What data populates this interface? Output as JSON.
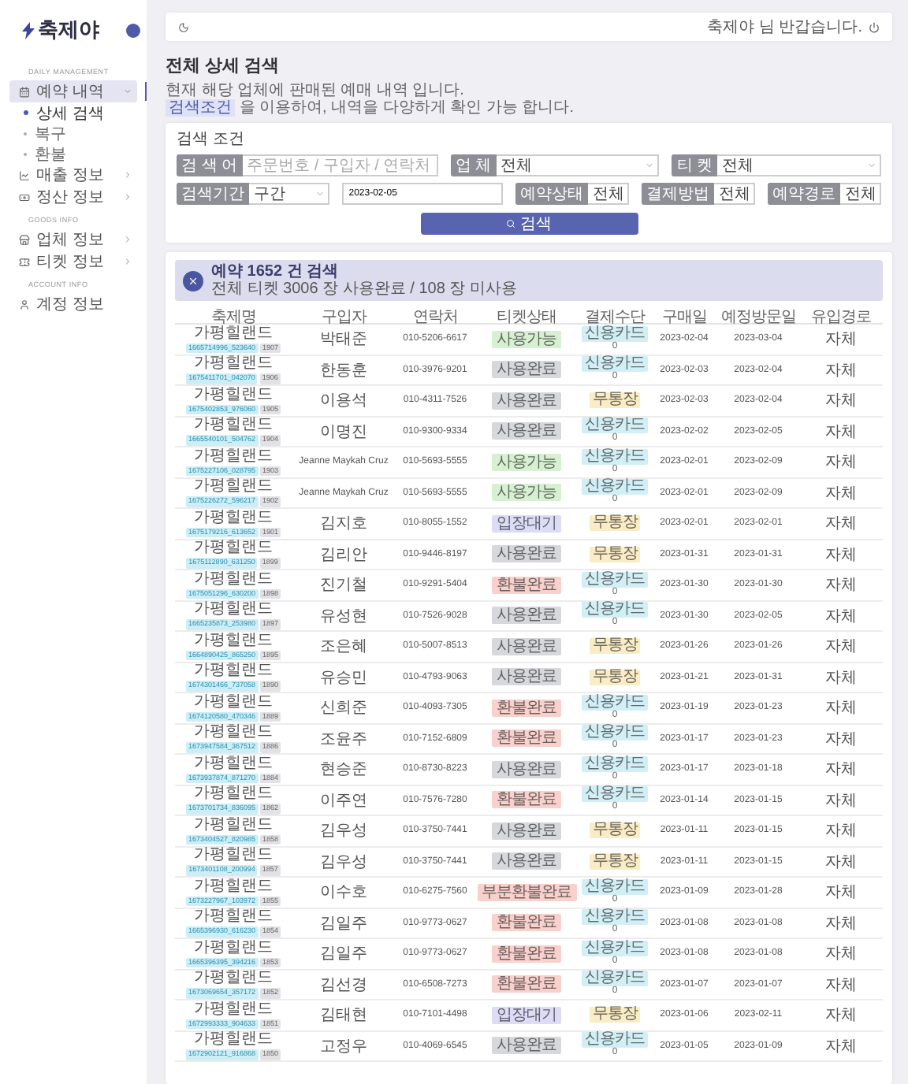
{
  "sidebar": {
    "logo": "축제야",
    "sections": [
      {
        "title": "DAILY MANAGEMENT",
        "items": [
          {
            "kind": "menu",
            "label": "예약 내역",
            "selected": true,
            "expanded": true,
            "children": [
              {
                "label": "상세 검색",
                "selected": true
              },
              {
                "label": "복구",
                "selected": false
              },
              {
                "label": "환불",
                "selected": false
              }
            ]
          },
          {
            "kind": "menu",
            "label": "매출 정보",
            "selected": false,
            "expanded": false
          },
          {
            "kind": "menu",
            "label": "정산 정보",
            "selected": false,
            "expanded": false
          }
        ]
      },
      {
        "title": "GOODS INFO",
        "items": [
          {
            "kind": "menu",
            "label": "업체 정보",
            "selected": false,
            "expanded": false
          },
          {
            "kind": "menu",
            "label": "티켓 정보",
            "selected": false,
            "expanded": false
          }
        ]
      },
      {
        "title": "ACCOUNT INFO",
        "items": [
          {
            "kind": "link",
            "label": "계정 정보",
            "selected": false
          }
        ]
      }
    ]
  },
  "header": {
    "greeting": "축제야 님 반갑습니다."
  },
  "page": {
    "title": "전체 상세 검색",
    "description": "현재 해당 업체에 판매된 예매 내역 입니다.",
    "hint_chip": "검색조건",
    "hint": "을 이용하여, 내역을 다양하게 확인 가능 합니다."
  },
  "search": {
    "title": "검색 조건",
    "primary_filters": [
      {
        "kind": "text",
        "label": "검 색 어",
        "placeholder": "주문번호 / 구입자 / 연락처"
      },
      {
        "kind": "select",
        "label": "업 체",
        "value": "전체"
      },
      {
        "kind": "select",
        "label": "티 켓",
        "value": "전체"
      }
    ],
    "secondary_filters": [
      {
        "kind": "select",
        "label": "검색기간",
        "value": "구간"
      },
      {
        "kind": "date",
        "value": "2023-02-05"
      },
      {
        "kind": "select",
        "label": "예약상태",
        "value": "전체"
      },
      {
        "kind": "select",
        "label": "결제방법",
        "value": "전체"
      },
      {
        "kind": "select",
        "label": "예약경로",
        "value": "전체"
      }
    ],
    "button": "검색"
  },
  "results": {
    "title": "예약 1652 건 검색",
    "subtitle": "전체 티켓 3006 장 사용완료 / 108 장 미사용",
    "columns": [
      "축제명",
      "구입자",
      "연락처",
      "티켓상태",
      "결제수단",
      "구매일",
      "예정방문일",
      "유입경로"
    ],
    "rows": [
      {
        "festival": "가평힐랜드",
        "order_no": "1665714996_523640",
        "ticket_no": "1907",
        "buyer": "박태준",
        "phone": "010-5206-6617",
        "status": {
          "label": "사용가능",
          "color": "#d8f0d2"
        },
        "payment": {
          "label": "신용카드",
          "color": "#d2eff6",
          "amount": "0"
        },
        "purchased": "2023-02-04",
        "visit": "2023-03-04",
        "channel": "자체"
      },
      {
        "festival": "가평힐랜드",
        "order_no": "1675411701_042070",
        "ticket_no": "1906",
        "buyer": "한동훈",
        "phone": "010-3976-9201",
        "status": {
          "label": "사용완료",
          "color": "#d6d8dc"
        },
        "payment": {
          "label": "신용카드",
          "color": "#d2eff6",
          "amount": "0"
        },
        "purchased": "2023-02-03",
        "visit": "2023-02-04",
        "channel": "자체"
      },
      {
        "festival": "가평힐랜드",
        "order_no": "1675402853_976060",
        "ticket_no": "1905",
        "buyer": "이용석",
        "phone": "010-4311-7526",
        "status": {
          "label": "사용완료",
          "color": "#d6d8dc"
        },
        "payment": {
          "label": "무통장",
          "color": "#faecc5"
        },
        "purchased": "2023-02-03",
        "visit": "2023-02-04",
        "channel": "자체"
      },
      {
        "festival": "가평힐랜드",
        "order_no": "1665540101_504762",
        "ticket_no": "1904",
        "buyer": "이명진",
        "phone": "010-9300-9334",
        "status": {
          "label": "사용완료",
          "color": "#d6d8dc"
        },
        "payment": {
          "label": "신용카드",
          "color": "#d2eff6",
          "amount": "0"
        },
        "purchased": "2023-02-02",
        "visit": "2023-02-05",
        "channel": "자체"
      },
      {
        "festival": "가평힐랜드",
        "order_no": "1675227106_028795",
        "ticket_no": "1903",
        "buyer": "Jeanne Maykah Cruz",
        "phone": "010-5693-5555",
        "status": {
          "label": "사용가능",
          "color": "#d8f0d2"
        },
        "payment": {
          "label": "신용카드",
          "color": "#d2eff6",
          "amount": "0"
        },
        "purchased": "2023-02-01",
        "visit": "2023-02-09",
        "channel": "자체"
      },
      {
        "festival": "가평힐랜드",
        "order_no": "1675226272_596217",
        "ticket_no": "1902",
        "buyer": "Jeanne Maykah Cruz",
        "phone": "010-5693-5555",
        "status": {
          "label": "사용가능",
          "color": "#d8f0d2"
        },
        "payment": {
          "label": "신용카드",
          "color": "#d2eff6",
          "amount": "0"
        },
        "purchased": "2023-02-01",
        "visit": "2023-02-09",
        "channel": "자체"
      },
      {
        "festival": "가평힐랜드",
        "order_no": "1675179216_613652",
        "ticket_no": "1901",
        "buyer": "김지호",
        "phone": "010-8055-1552",
        "status": {
          "label": "입장대기",
          "color": "#dcdcf6"
        },
        "payment": {
          "label": "무통장",
          "color": "#faecc5"
        },
        "purchased": "2023-02-01",
        "visit": "2023-02-01",
        "channel": "자체"
      },
      {
        "festival": "가평힐랜드",
        "order_no": "1675112890_631250",
        "ticket_no": "1899",
        "buyer": "김리안",
        "phone": "010-9446-8197",
        "status": {
          "label": "사용완료",
          "color": "#d6d8dc"
        },
        "payment": {
          "label": "무통장",
          "color": "#faecc5"
        },
        "purchased": "2023-01-31",
        "visit": "2023-01-31",
        "channel": "자체"
      },
      {
        "festival": "가평힐랜드",
        "order_no": "1675051296_630200",
        "ticket_no": "1898",
        "buyer": "진기철",
        "phone": "010-9291-5404",
        "status": {
          "label": "환불완료",
          "color": "#f8d1cd"
        },
        "payment": {
          "label": "신용카드",
          "color": "#d2eff6",
          "amount": "0"
        },
        "purchased": "2023-01-30",
        "visit": "2023-01-30",
        "channel": "자체"
      },
      {
        "festival": "가평힐랜드",
        "order_no": "1665235873_253980",
        "ticket_no": "1897",
        "buyer": "유성현",
        "phone": "010-7526-9028",
        "status": {
          "label": "사용완료",
          "color": "#d6d8dc"
        },
        "payment": {
          "label": "신용카드",
          "color": "#d2eff6",
          "amount": "0"
        },
        "purchased": "2023-01-30",
        "visit": "2023-02-05",
        "channel": "자체"
      },
      {
        "festival": "가평힐랜드",
        "order_no": "1664890425_865250",
        "ticket_no": "1895",
        "buyer": "조은혜",
        "phone": "010-5007-8513",
        "status": {
          "label": "사용완료",
          "color": "#d6d8dc"
        },
        "payment": {
          "label": "무통장",
          "color": "#faecc5"
        },
        "purchased": "2023-01-26",
        "visit": "2023-01-26",
        "channel": "자체"
      },
      {
        "festival": "가평힐랜드",
        "order_no": "1674301466_737058",
        "ticket_no": "1890",
        "buyer": "유승민",
        "phone": "010-4793-9063",
        "status": {
          "label": "사용완료",
          "color": "#d6d8dc"
        },
        "payment": {
          "label": "무통장",
          "color": "#faecc5"
        },
        "purchased": "2023-01-21",
        "visit": "2023-01-31",
        "channel": "자체"
      },
      {
        "festival": "가평힐랜드",
        "order_no": "1674120580_470346",
        "ticket_no": "1889",
        "buyer": "신희준",
        "phone": "010-4093-7305",
        "status": {
          "label": "환불완료",
          "color": "#f8d1cd"
        },
        "payment": {
          "label": "신용카드",
          "color": "#d2eff6",
          "amount": "0"
        },
        "purchased": "2023-01-19",
        "visit": "2023-01-23",
        "channel": "자체"
      },
      {
        "festival": "가평힐랜드",
        "order_no": "1673947584_367512",
        "ticket_no": "1886",
        "buyer": "조윤주",
        "phone": "010-7152-6809",
        "status": {
          "label": "환불완료",
          "color": "#f8d1cd"
        },
        "payment": {
          "label": "신용카드",
          "color": "#d2eff6",
          "amount": "0"
        },
        "purchased": "2023-01-17",
        "visit": "2023-01-23",
        "channel": "자체"
      },
      {
        "festival": "가평힐랜드",
        "order_no": "1673937874_871270",
        "ticket_no": "1884",
        "buyer": "현승준",
        "phone": "010-8730-8223",
        "status": {
          "label": "사용완료",
          "color": "#d6d8dc"
        },
        "payment": {
          "label": "신용카드",
          "color": "#d2eff6",
          "amount": "0"
        },
        "purchased": "2023-01-17",
        "visit": "2023-01-18",
        "channel": "자체"
      },
      {
        "festival": "가평힐랜드",
        "order_no": "1673701734_836095",
        "ticket_no": "1862",
        "buyer": "이주연",
        "phone": "010-7576-7280",
        "status": {
          "label": "환불완료",
          "color": "#f8d1cd"
        },
        "payment": {
          "label": "신용카드",
          "color": "#d2eff6",
          "amount": "0"
        },
        "purchased": "2023-01-14",
        "visit": "2023-01-15",
        "channel": "자체"
      },
      {
        "festival": "가평힐랜드",
        "order_no": "1673404527_820985",
        "ticket_no": "1858",
        "buyer": "김우성",
        "phone": "010-3750-7441",
        "status": {
          "label": "사용완료",
          "color": "#d6d8dc"
        },
        "payment": {
          "label": "무통장",
          "color": "#faecc5"
        },
        "purchased": "2023-01-11",
        "visit": "2023-01-15",
        "channel": "자체"
      },
      {
        "festival": "가평힐랜드",
        "order_no": "1673401108_200994",
        "ticket_no": "1857",
        "buyer": "김우성",
        "phone": "010-3750-7441",
        "status": {
          "label": "사용완료",
          "color": "#d6d8dc"
        },
        "payment": {
          "label": "무통장",
          "color": "#faecc5"
        },
        "purchased": "2023-01-11",
        "visit": "2023-01-15",
        "channel": "자체"
      },
      {
        "festival": "가평힐랜드",
        "order_no": "1673227967_103972",
        "ticket_no": "1855",
        "buyer": "이수호",
        "phone": "010-6275-7560",
        "status": {
          "label": "부분환불완료",
          "color": "#f8d1cd"
        },
        "payment": {
          "label": "신용카드",
          "color": "#d2eff6",
          "amount": "0"
        },
        "purchased": "2023-01-09",
        "visit": "2023-01-28",
        "channel": "자체"
      },
      {
        "festival": "가평힐랜드",
        "order_no": "1665396930_616230",
        "ticket_no": "1854",
        "buyer": "김일주",
        "phone": "010-9773-0627",
        "status": {
          "label": "환불완료",
          "color": "#f8d1cd"
        },
        "payment": {
          "label": "신용카드",
          "color": "#d2eff6",
          "amount": "0"
        },
        "purchased": "2023-01-08",
        "visit": "2023-01-08",
        "channel": "자체"
      },
      {
        "festival": "가평힐랜드",
        "order_no": "1665396395_394216",
        "ticket_no": "1853",
        "buyer": "김일주",
        "phone": "010-9773-0627",
        "status": {
          "label": "환불완료",
          "color": "#f8d1cd"
        },
        "payment": {
          "label": "신용카드",
          "color": "#d2eff6",
          "amount": "0"
        },
        "purchased": "2023-01-08",
        "visit": "2023-01-08",
        "channel": "자체"
      },
      {
        "festival": "가평힐랜드",
        "order_no": "1673069654_357172",
        "ticket_no": "1852",
        "buyer": "김선경",
        "phone": "010-6508-7273",
        "status": {
          "label": "환불완료",
          "color": "#f8d1cd"
        },
        "payment": {
          "label": "신용카드",
          "color": "#d2eff6",
          "amount": "0"
        },
        "purchased": "2023-01-07",
        "visit": "2023-01-07",
        "channel": "자체"
      },
      {
        "festival": "가평힐랜드",
        "order_no": "1672993333_904633",
        "ticket_no": "1851",
        "buyer": "김태현",
        "phone": "010-7101-4498",
        "status": {
          "label": "입장대기",
          "color": "#dcdcf6"
        },
        "payment": {
          "label": "무통장",
          "color": "#faecc5"
        },
        "purchased": "2023-01-06",
        "visit": "2023-02-11",
        "channel": "자체"
      },
      {
        "festival": "가평힐랜드",
        "order_no": "1672902121_916868",
        "ticket_no": "1850",
        "buyer": "고정우",
        "phone": "010-4069-6545",
        "status": {
          "label": "사용완료",
          "color": "#d6d8dc"
        },
        "payment": {
          "label": "신용카드",
          "color": "#d2eff6",
          "amount": "0"
        },
        "purchased": "2023-01-05",
        "visit": "2023-01-09",
        "channel": "자체"
      }
    ]
  }
}
